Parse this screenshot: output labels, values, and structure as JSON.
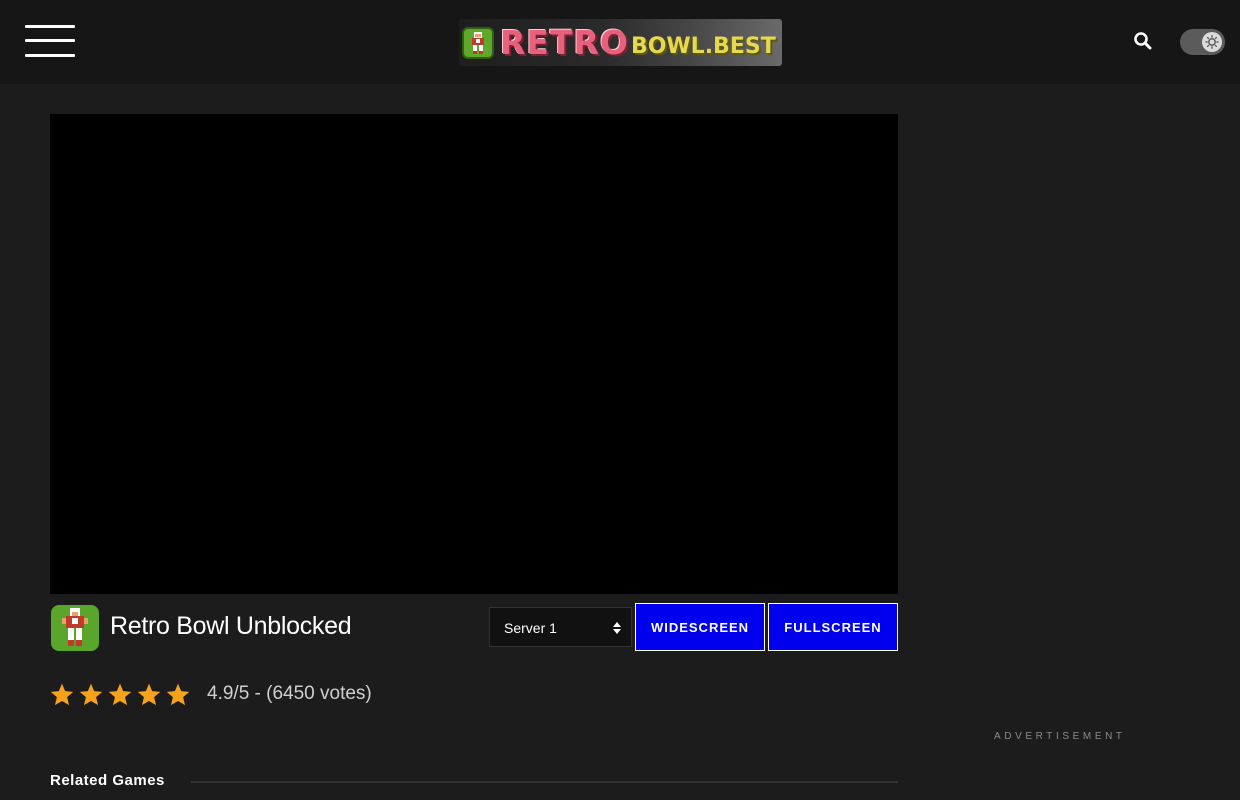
{
  "header": {
    "logo": {
      "retro_text": "RETRO",
      "domain_text": "BOWL.BEST"
    },
    "icons": [
      "menu-icon",
      "search-icon",
      "theme-toggle-icon"
    ]
  },
  "game": {
    "title": "Retro Bowl Unblocked",
    "server_select": {
      "selected": "Server 1"
    },
    "buttons": {
      "widescreen": "WIDESCREEN",
      "fullscreen": "FULLSCREEN"
    },
    "rating": {
      "stars_filled": 5,
      "stars_total": 5,
      "text": "4.9/5 - (6450 votes)"
    }
  },
  "sidebar": {
    "ad_label": "ADVERTISEMENT"
  },
  "related": {
    "heading": "Related Games"
  },
  "colors": {
    "page_bg": "#1c1c1c",
    "header_bg": "#161616",
    "button_blue": "#0000ee",
    "star_orange": "#f7a21b"
  }
}
